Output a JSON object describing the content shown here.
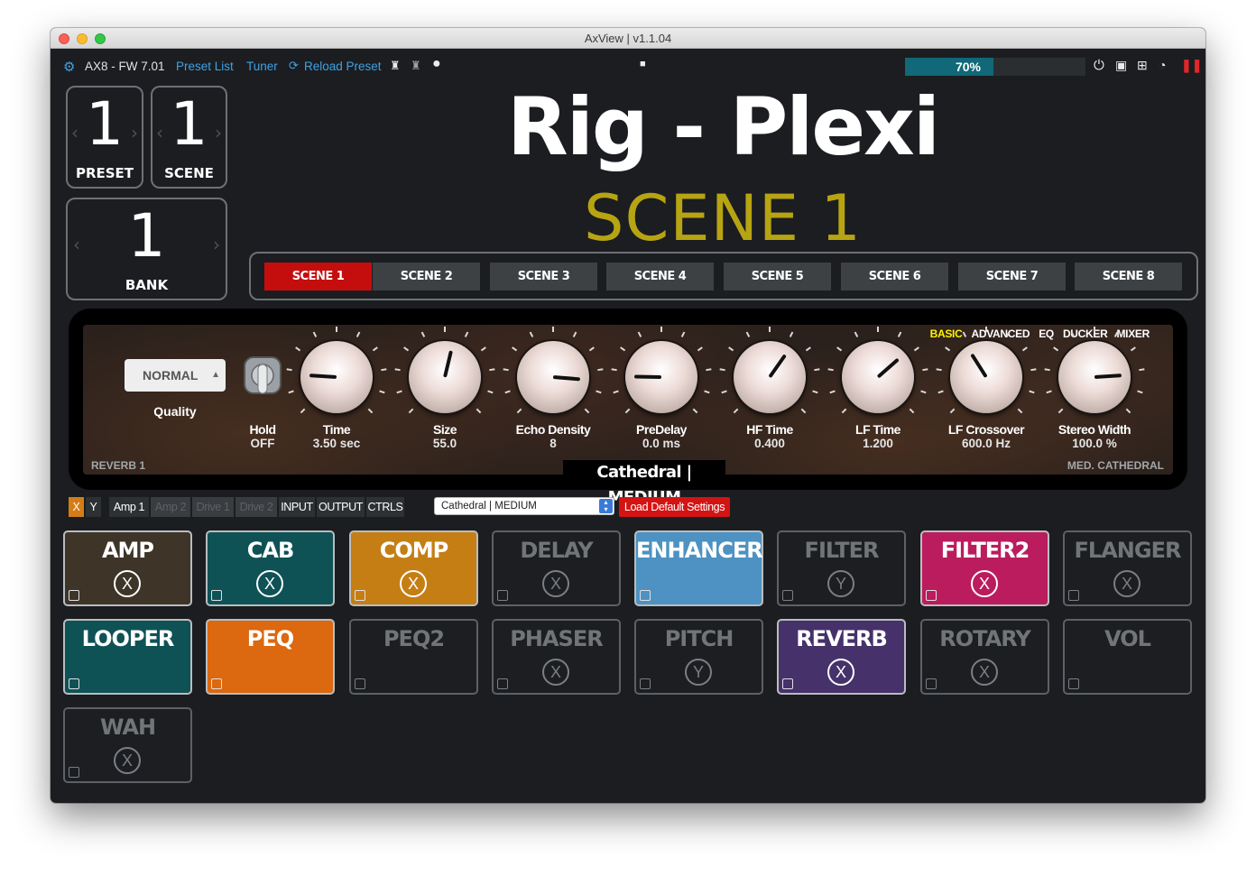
{
  "window": {
    "title": "AxView | v1.1.04"
  },
  "toolbar": {
    "device": "AX8 - FW 7.01",
    "preset_list": "Preset List",
    "tuner": "Tuner",
    "reload": "Reload Preset",
    "progress_label": "70%",
    "progress_value": 0.7
  },
  "counters": {
    "preset_value": "1",
    "preset_label": "PRESET",
    "scene_value": "1",
    "scene_label": "SCENE",
    "bank_value": "1",
    "bank_label": "BANK"
  },
  "preset_name": "Rig - Plexi",
  "scene_name": "SCENE 1",
  "scenes": [
    "SCENE 1",
    "SCENE 2",
    "SCENE 3",
    "SCENE 4",
    "SCENE 5",
    "SCENE 6",
    "SCENE 7",
    "SCENE 8"
  ],
  "active_scene": 0,
  "effect": {
    "tabs": [
      "BASIC",
      "ADVANCED",
      "EQ",
      "DUCKER",
      "MIXER"
    ],
    "quality_value": "NORMAL",
    "quality_label": "Quality",
    "hold_label": "Hold",
    "hold_value": "OFF",
    "block_label": "REVERB 1",
    "type_label": "MED. CATHEDRAL",
    "name": "Cathedral | MEDIUM",
    "params": [
      {
        "label": "Time",
        "value": "3.50 sec",
        "knob": 0.18
      },
      {
        "label": "Size",
        "value": "55.0",
        "knob": 0.55
      },
      {
        "label": "Echo Density",
        "value": "8",
        "knob": 0.85
      },
      {
        "label": "PreDelay",
        "value": "0.0 ms",
        "knob": 0.17
      },
      {
        "label": "HF Time",
        "value": "0.400",
        "knob": 0.63
      },
      {
        "label": "LF Time",
        "value": "1.200",
        "knob": 0.68
      },
      {
        "label": "LF Crossover",
        "value": "600.0 Hz",
        "knob": 0.38
      },
      {
        "label": "Stereo Width",
        "value": "100.0 %",
        "knob": 0.82
      }
    ]
  },
  "controls_row": {
    "x": "X",
    "y": "Y",
    "tabs": [
      "Amp 1",
      "Amp 2",
      "Drive 1",
      "Drive 2",
      "INPUT",
      "OUTPUT",
      "CTRLS"
    ],
    "select_value": "Cathedral | MEDIUM",
    "load_default": "Load Default Settings"
  },
  "blocks": [
    {
      "name": "AMP",
      "state": "X",
      "on": true,
      "color": "#3e3428"
    },
    {
      "name": "CAB",
      "state": "X",
      "on": true,
      "color": "#0f5256"
    },
    {
      "name": "COMP",
      "state": "X",
      "on": true,
      "color": "#c57e14"
    },
    {
      "name": "DELAY",
      "state": "X",
      "on": false,
      "color": ""
    },
    {
      "name": "ENHANCER",
      "state": "",
      "on": true,
      "color": "#4d92c2"
    },
    {
      "name": "FILTER",
      "state": "Y",
      "on": false,
      "color": ""
    },
    {
      "name": "FILTER2",
      "state": "X",
      "on": true,
      "color": "#bb1c5d"
    },
    {
      "name": "FLANGER",
      "state": "X",
      "on": false,
      "color": ""
    },
    {
      "name": "LOOPER",
      "state": "",
      "on": true,
      "color": "#0f5256"
    },
    {
      "name": "PEQ",
      "state": "",
      "on": true,
      "color": "#dc6810"
    },
    {
      "name": "PEQ2",
      "state": "",
      "on": false,
      "color": ""
    },
    {
      "name": "PHASER",
      "state": "X",
      "on": false,
      "color": ""
    },
    {
      "name": "PITCH",
      "state": "Y",
      "on": false,
      "color": ""
    },
    {
      "name": "REVERB",
      "state": "X",
      "on": true,
      "color": "#46316b"
    },
    {
      "name": "ROTARY",
      "state": "X",
      "on": false,
      "color": ""
    },
    {
      "name": "VOL",
      "state": "",
      "on": false,
      "color": ""
    },
    {
      "name": "WAH",
      "state": "X",
      "on": false,
      "color": ""
    }
  ],
  "colors": {
    "accent_link": "#3ea2e6",
    "scene_active": "#c40e0e",
    "scene_title": "#b7a413",
    "tab_active": "#fff200"
  }
}
